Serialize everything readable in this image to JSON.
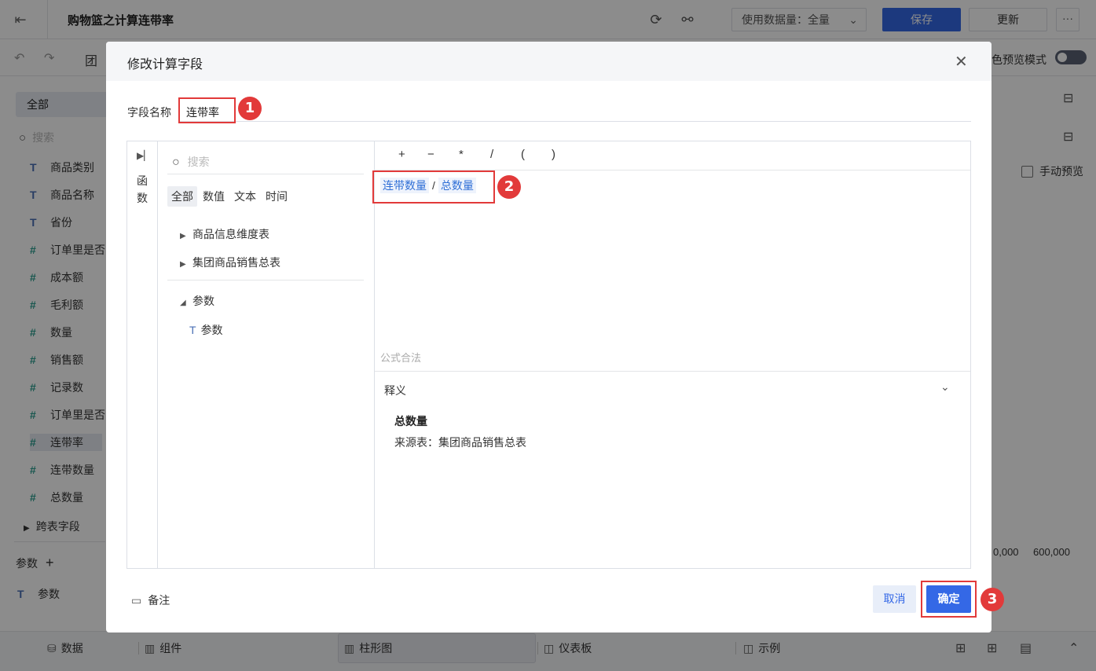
{
  "topbar": {
    "title": "购物篮之计算连带率",
    "usage_label": "使用数据量：全量",
    "save": "保存",
    "update": "更新",
    "more": "···"
  },
  "toolbar": {
    "preview_mode": "色预览模式",
    "icon_chart": "团"
  },
  "left_panel": {
    "all": "全部",
    "search_placeholder": "搜索",
    "fields": [
      {
        "icon": "T",
        "label": "商品类别"
      },
      {
        "icon": "T",
        "label": "商品名称"
      },
      {
        "icon": "T",
        "label": "省份"
      },
      {
        "icon": "#",
        "label": "订单里是否"
      },
      {
        "icon": "#",
        "label": "成本额"
      },
      {
        "icon": "#",
        "label": "毛利额"
      },
      {
        "icon": "#",
        "label": "数量"
      },
      {
        "icon": "#",
        "label": "销售额"
      },
      {
        "icon": "#",
        "label": "记录数"
      },
      {
        "icon": "#",
        "label": "订单里是否"
      },
      {
        "icon": "#",
        "label": "连带率"
      },
      {
        "icon": "#",
        "label": "连带数量"
      },
      {
        "icon": "#",
        "label": "总数量"
      }
    ],
    "cross_table": "跨表字段",
    "params_header": "参数",
    "params_item": "参数"
  },
  "right_panel": {
    "manual_preview": "手动预览",
    "axis_labels": [
      "0,000",
      "600,000"
    ]
  },
  "bottombar": {
    "data": "数据",
    "components": "组件",
    "tab": "柱形图",
    "dashboard": "仪表板",
    "example": "示例"
  },
  "dialog": {
    "title": "修改计算字段",
    "field_name_label": "字段名称",
    "field_name_value": "连带率",
    "fn_tab": [
      "函",
      "数"
    ],
    "tree_search_placeholder": "搜索",
    "tree_tabs": [
      "全部",
      "数值",
      "文本",
      "时间"
    ],
    "tree_nodes": [
      "商品信息维度表",
      "集团商品销售总表",
      "参数",
      "参数"
    ],
    "operators": [
      "+",
      "−",
      "*",
      "/",
      "(",
      ")"
    ],
    "formula_left": "连带数量",
    "formula_op": "/",
    "formula_right": "总数量",
    "validity": "公式合法",
    "definition_label": "释义",
    "definition_title": "总数量",
    "definition_source": "来源表：集团商品销售总表",
    "note": "备注",
    "cancel": "取消",
    "ok": "确定"
  },
  "annotations": [
    "1",
    "2",
    "3"
  ]
}
